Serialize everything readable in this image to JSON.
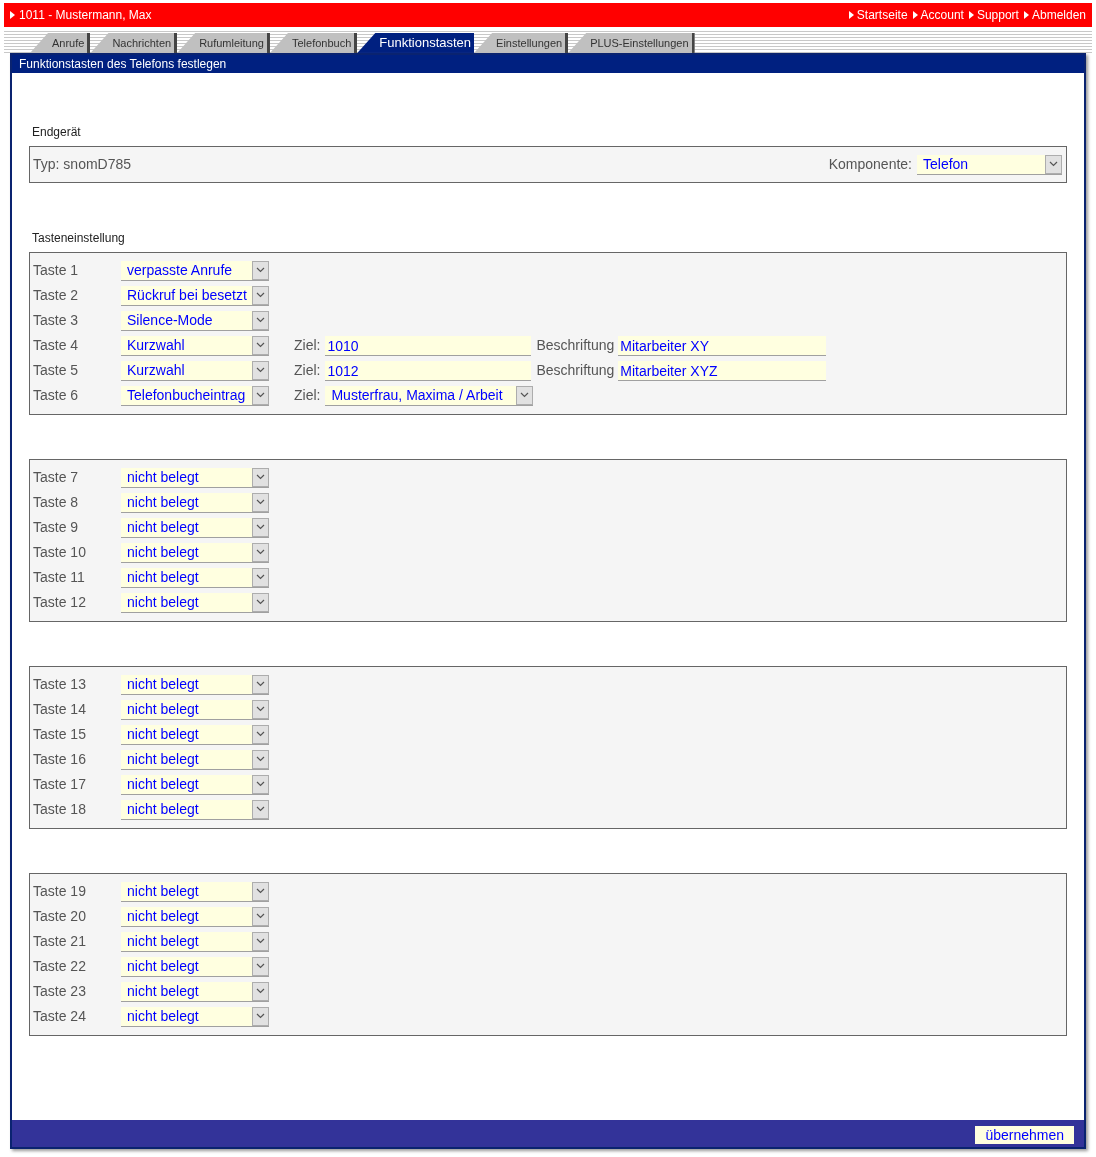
{
  "header": {
    "user": "1011 - Mustermann, Max",
    "links": [
      "Startseite",
      "Account",
      "Support",
      "Abmelden"
    ]
  },
  "tabs": [
    {
      "label": "Anrufe",
      "selected": false
    },
    {
      "label": "Nachrichten",
      "selected": false
    },
    {
      "label": "Rufumleitung",
      "selected": false
    },
    {
      "label": "Telefonbuch",
      "selected": false
    },
    {
      "label": "Funktionstasten",
      "selected": true
    },
    {
      "label": "Einstellungen",
      "selected": false
    },
    {
      "label": "PLUS-Einstellungen",
      "selected": false
    }
  ],
  "panel_title": "Funktionstasten des Telefons festlegen",
  "device": {
    "heading": "Endgerät",
    "type": "Typ: snomD785",
    "component_label": "Komponente:",
    "component_value": "Telefon"
  },
  "keys_heading": "Tasteneinstellung",
  "groups": [
    [
      {
        "label": "Taste 1",
        "value": "verpasste Anrufe"
      },
      {
        "label": "Taste 2",
        "value": "Rückruf bei besetzt"
      },
      {
        "label": "Taste 3",
        "value": "Silence-Mode"
      },
      {
        "label": "Taste 4",
        "value": "Kurzwahl",
        "target": {
          "kind": "text",
          "label": "Ziel:",
          "value": "1010"
        },
        "caption": {
          "label": "Beschriftung",
          "value": "Mitarbeiter XY"
        }
      },
      {
        "label": "Taste 5",
        "value": "Kurzwahl",
        "target": {
          "kind": "text",
          "label": "Ziel:",
          "value": "1012"
        },
        "caption": {
          "label": "Beschriftung",
          "value": "Mitarbeiter XYZ"
        }
      },
      {
        "label": "Taste 6",
        "value": "Telefonbucheintrag",
        "target": {
          "kind": "select",
          "label": "Ziel:",
          "value": "Musterfrau, Maxima / Arbeit"
        }
      }
    ],
    [
      {
        "label": "Taste 7",
        "value": "nicht belegt"
      },
      {
        "label": "Taste 8",
        "value": "nicht belegt"
      },
      {
        "label": "Taste 9",
        "value": "nicht belegt"
      },
      {
        "label": "Taste 10",
        "value": "nicht belegt"
      },
      {
        "label": "Taste 11",
        "value": "nicht belegt"
      },
      {
        "label": "Taste 12",
        "value": "nicht belegt"
      }
    ],
    [
      {
        "label": "Taste 13",
        "value": "nicht belegt"
      },
      {
        "label": "Taste 14",
        "value": "nicht belegt"
      },
      {
        "label": "Taste 15",
        "value": "nicht belegt"
      },
      {
        "label": "Taste 16",
        "value": "nicht belegt"
      },
      {
        "label": "Taste 17",
        "value": "nicht belegt"
      },
      {
        "label": "Taste 18",
        "value": "nicht belegt"
      }
    ],
    [
      {
        "label": "Taste 19",
        "value": "nicht belegt"
      },
      {
        "label": "Taste 20",
        "value": "nicht belegt"
      },
      {
        "label": "Taste 21",
        "value": "nicht belegt"
      },
      {
        "label": "Taste 22",
        "value": "nicht belegt"
      },
      {
        "label": "Taste 23",
        "value": "nicht belegt"
      },
      {
        "label": "Taste 24",
        "value": "nicht belegt"
      }
    ]
  ],
  "submit": "übernehmen"
}
